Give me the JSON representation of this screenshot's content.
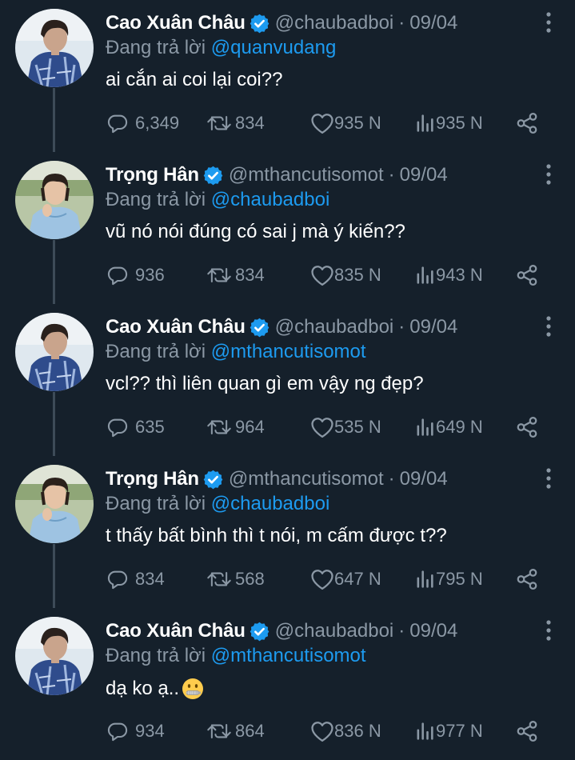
{
  "colors": {
    "background": "#15202b",
    "muted": "#8b98a5",
    "mention": "#1d9bf0",
    "verified": "#1d9bf0",
    "thread_line": "#3d4b58"
  },
  "tweets": [
    {
      "name": "Cao Xuân Châu",
      "handle": "@chaubadboi",
      "separator": "·",
      "date": "09/04",
      "reply_prefix": "Đang trả lời",
      "reply_to": "@quanvudang",
      "text": "ai cắn ai coi lại coi??",
      "replies": "6,349",
      "retweets": "834",
      "likes": "935 N",
      "views": "935 N",
      "avatar": "cao-xuan-chau-avatar",
      "verified": true
    },
    {
      "name": "Trọng Hân",
      "handle": "@mthancutisomot",
      "separator": "·",
      "date": "09/04",
      "reply_prefix": "Đang trả lời",
      "reply_to": "@chaubadboi",
      "text": "vũ nó nói đúng có sai j mà ý kiến??",
      "replies": "936",
      "retweets": "834",
      "likes": "835 N",
      "views": "943 N",
      "avatar": "trong-han-avatar",
      "verified": true
    },
    {
      "name": "Cao Xuân Châu",
      "handle": "@chaubadboi",
      "separator": "·",
      "date": "09/04",
      "reply_prefix": "Đang trả lời",
      "reply_to": "@mthancutisomot",
      "text": "vcl?? thì liên quan gì em vậy ng đẹp?",
      "replies": "635",
      "retweets": "964",
      "likes": "535 N",
      "views": "649 N",
      "avatar": "cao-xuan-chau-avatar",
      "verified": true
    },
    {
      "name": "Trọng Hân",
      "handle": "@mthancutisomot",
      "separator": "·",
      "date": "09/04",
      "reply_prefix": "Đang trả lời",
      "reply_to": "@chaubadboi",
      "text": "t thấy bất bình thì t nói, m cấm được t??",
      "replies": "834",
      "retweets": "568",
      "likes": "647 N",
      "views": "795 N",
      "avatar": "trong-han-avatar",
      "verified": true
    },
    {
      "name": "Cao Xuân Châu",
      "handle": "@chaubadboi",
      "separator": "·",
      "date": "09/04",
      "reply_prefix": "Đang trả lời",
      "reply_to": "@mthancutisomot",
      "text": "dạ ko ạ..",
      "emoji": "zipper-mouth-face",
      "replies": "934",
      "retweets": "864",
      "likes": "836 N",
      "views": "977 N",
      "avatar": "cao-xuan-chau-avatar",
      "verified": true
    }
  ]
}
